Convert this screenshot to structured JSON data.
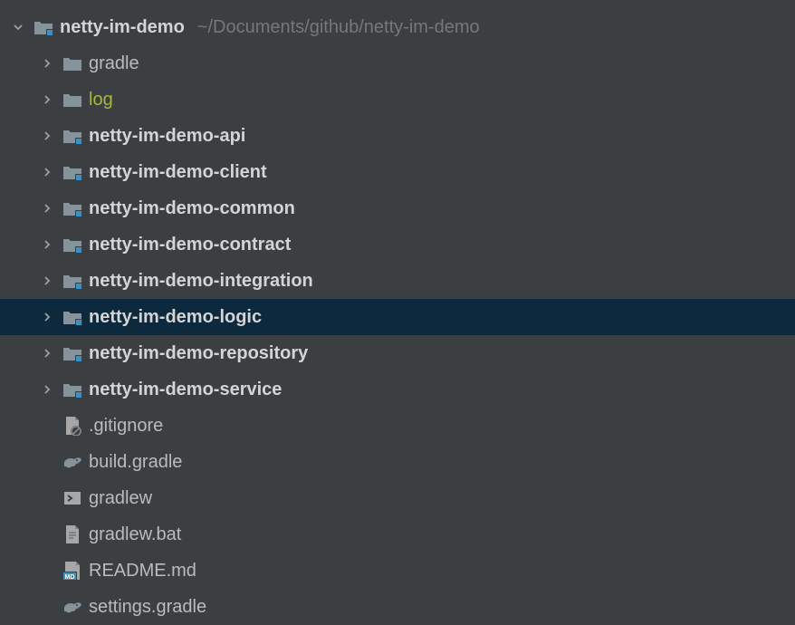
{
  "root": {
    "name": "netty-im-demo",
    "path_hint": "~/Documents/github/netty-im-demo"
  },
  "children": [
    {
      "label": "gradle",
      "icon": "folder",
      "bold": false,
      "expandable": true,
      "color": "normal"
    },
    {
      "label": "log",
      "icon": "folder",
      "bold": false,
      "expandable": true,
      "color": "olive"
    },
    {
      "label": "netty-im-demo-api",
      "icon": "module",
      "bold": true,
      "expandable": true,
      "color": "normal"
    },
    {
      "label": "netty-im-demo-client",
      "icon": "module",
      "bold": true,
      "expandable": true,
      "color": "normal"
    },
    {
      "label": "netty-im-demo-common",
      "icon": "module",
      "bold": true,
      "expandable": true,
      "color": "normal"
    },
    {
      "label": "netty-im-demo-contract",
      "icon": "module",
      "bold": true,
      "expandable": true,
      "color": "normal"
    },
    {
      "label": "netty-im-demo-integration",
      "icon": "module",
      "bold": true,
      "expandable": true,
      "color": "normal"
    },
    {
      "label": "netty-im-demo-logic",
      "icon": "module",
      "bold": true,
      "expandable": true,
      "color": "normal",
      "selected": true
    },
    {
      "label": "netty-im-demo-repository",
      "icon": "module",
      "bold": true,
      "expandable": true,
      "color": "normal"
    },
    {
      "label": "netty-im-demo-service",
      "icon": "module",
      "bold": true,
      "expandable": true,
      "color": "normal"
    },
    {
      "label": ".gitignore",
      "icon": "gitignore",
      "bold": false,
      "expandable": false,
      "color": "normal"
    },
    {
      "label": "build.gradle",
      "icon": "gradle",
      "bold": false,
      "expandable": false,
      "color": "normal"
    },
    {
      "label": "gradlew",
      "icon": "shell",
      "bold": false,
      "expandable": false,
      "color": "normal"
    },
    {
      "label": "gradlew.bat",
      "icon": "textfile",
      "bold": false,
      "expandable": false,
      "color": "normal"
    },
    {
      "label": "README.md",
      "icon": "markdown",
      "bold": false,
      "expandable": false,
      "color": "normal"
    },
    {
      "label": "settings.gradle",
      "icon": "gradle",
      "bold": false,
      "expandable": false,
      "color": "normal"
    }
  ]
}
